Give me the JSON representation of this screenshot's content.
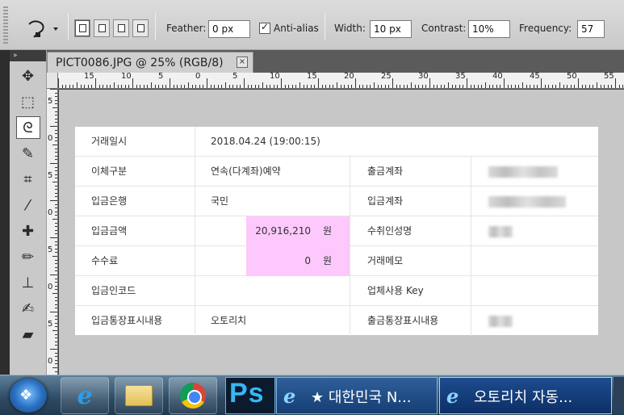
{
  "options_bar": {
    "feather_label": "Feather:",
    "feather_value": "0 px",
    "antialias_label": "Anti-alias",
    "antialias_checked": true,
    "width_label": "Width:",
    "width_value": "10 px",
    "contrast_label": "Contrast:",
    "contrast_value": "10%",
    "frequency_label": "Frequency:",
    "frequency_value": "57",
    "tool_icon": "magnetic-lasso-icon"
  },
  "toolbar": {
    "collapse_label": "»",
    "tools": [
      {
        "name": "move-icon",
        "glyph": "✥"
      },
      {
        "name": "marquee-icon",
        "glyph": "⬚"
      },
      {
        "name": "lasso-icon",
        "glyph": "ᘓ",
        "active": true
      },
      {
        "name": "quick-selection-icon",
        "glyph": "✎"
      },
      {
        "name": "crop-icon",
        "glyph": "⌗"
      },
      {
        "name": "eyedropper-icon",
        "glyph": "⁄"
      },
      {
        "name": "healing-brush-icon",
        "glyph": "✚"
      },
      {
        "name": "brush-icon",
        "glyph": "✏"
      },
      {
        "name": "stamp-icon",
        "glyph": "⊥"
      },
      {
        "name": "history-brush-icon",
        "glyph": "✍"
      },
      {
        "name": "eraser-icon",
        "glyph": "▰"
      }
    ]
  },
  "document": {
    "tab_title": "PICT0086.JPG @ 25% (RGB/8)",
    "close_label": "×"
  },
  "ruler": {
    "h_labels": [
      "15",
      "10",
      "5",
      "0",
      "5",
      "10",
      "15",
      "20",
      "25",
      "30",
      "35",
      "40",
      "45",
      "50",
      "55"
    ],
    "v_labels": [
      "5",
      "0",
      "5",
      "0",
      "5",
      "0",
      "5",
      "0",
      "5"
    ]
  },
  "transfer": {
    "rows": [
      {
        "label": "거래일시",
        "value": "2018.04.24 (19:00:15)"
      },
      {
        "label": "이체구분",
        "value": "연속(다계좌)예약",
        "label2": "출금계좌"
      },
      {
        "label": "입금은행",
        "value": "국민",
        "label2": "입금계좌"
      },
      {
        "label": "입금금액",
        "amount": "20,916,210",
        "unit": "원",
        "label2": "수취인성명"
      },
      {
        "label": "수수료",
        "amount": "0",
        "unit": "원",
        "label2": "거래메모"
      },
      {
        "label": "입금인코드",
        "value": "",
        "label2": "업체사용 Key"
      },
      {
        "label": "입금통장표시내용",
        "value": "오토리치",
        "label2": "출금통장표시내용"
      }
    ]
  },
  "taskbar": {
    "start_glyph": "❖",
    "ie_glyph": "e",
    "ps_label": "Ps",
    "items": [
      {
        "label": "★ 대한민국 N..."
      },
      {
        "label": "오토리치 자동..."
      }
    ]
  },
  "colors": {
    "highlight": "#fdc8fb",
    "taskbar": "#2d4a63",
    "ps_blue": "#35b7f3"
  }
}
